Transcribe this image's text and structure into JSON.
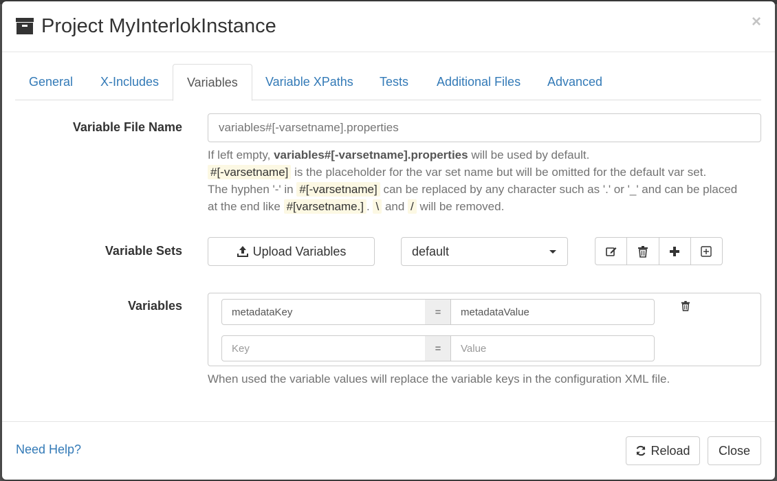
{
  "modal": {
    "title": "Project MyInterlokInstance",
    "close_symbol": "×",
    "title_icon": "archive-icon"
  },
  "tabs": [
    {
      "label": "General",
      "active": false
    },
    {
      "label": "X-Includes",
      "active": false
    },
    {
      "label": "Variables",
      "active": true
    },
    {
      "label": "Variable XPaths",
      "active": false
    },
    {
      "label": "Tests",
      "active": false
    },
    {
      "label": "Additional Files",
      "active": false
    },
    {
      "label": "Advanced",
      "active": false
    }
  ],
  "variable_file": {
    "label": "Variable File Name",
    "value": "",
    "placeholder": "variables#[-varsetname].properties",
    "help": {
      "line1_prefix": "If left empty, ",
      "line1_bold": "variables#[-varsetname].properties",
      "line1_suffix": " will be used by default.",
      "line2_code": "#[-varsetname]",
      "line2_text": " is the placeholder for the var set name but will be omitted for the default var set.",
      "line3_prefix": "The hyphen '-' in ",
      "line3_code": "#[-varsetname]",
      "line3_suffix": " can be replaced by any character such as '.' or '_' and can be placed",
      "line4_prefix": "at the end like ",
      "line4_code1": "#[varsetname.]",
      "line4_mid1": ". ",
      "line4_code2": "\\",
      "line4_mid2": " and ",
      "line4_code3": "/",
      "line4_suffix": " will be removed."
    }
  },
  "variable_sets": {
    "label": "Variable Sets",
    "upload_label": "Upload Variables",
    "selected": "default",
    "actions": [
      "edit-icon",
      "trash-icon",
      "plus-icon",
      "plus-square-icon"
    ]
  },
  "variables": {
    "label": "Variables",
    "rows": [
      {
        "key": "metadataKey",
        "value": "metadataValue"
      }
    ],
    "new_row": {
      "key_placeholder": "Key",
      "value_placeholder": "Value"
    },
    "separator": "=",
    "help": "When used the variable values will replace the variable keys in the configuration XML file."
  },
  "footer": {
    "help_link": "Need Help?",
    "reload_label": "Reload",
    "close_label": "Close"
  },
  "colors": {
    "link": "#337ab7",
    "code_bg": "#fcf8e3",
    "border": "#cccccc"
  }
}
